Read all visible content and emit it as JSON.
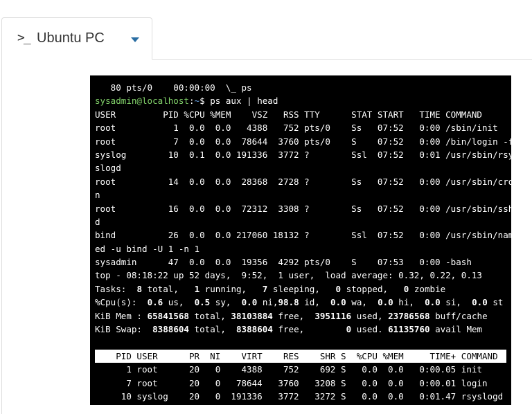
{
  "tab": {
    "prompt_glyph": ">_",
    "label": "Ubuntu PC"
  },
  "terminal": {
    "colors": {
      "background": "#000000",
      "text": "#ffffff",
      "user_host": "#82d26a",
      "path": "#6da6e8"
    },
    "line0": "   80 pts/0    00:00:00  \\_ ps",
    "prompt": {
      "user_host": "sysadmin@localhost",
      "sep": ":",
      "path": "~",
      "symbol": "$ ",
      "command": "ps aux | head"
    },
    "ps": [
      "USER         PID %CPU %MEM    VSZ   RSS TTY      STAT START   TIME COMMAND",
      "root           1  0.0  0.0   4388   752 pts/0    Ss   07:52   0:00 /sbin/init",
      "root           7  0.0  0.0  78644  3760 pts/0    S    07:52   0:00 /bin/login -f",
      "syslog        10  0.1  0.0 191336  3772 ?        Ssl  07:52   0:01 /usr/sbin/rsy",
      "slogd",
      "root          14  0.0  0.0  28368  2728 ?        Ss   07:52   0:00 /usr/sbin/cro",
      "n",
      "root          16  0.0  0.0  72312  3308 ?        Ss   07:52   0:00 /usr/sbin/ssh",
      "d",
      "bind          26  0.0  0.0 217060 18132 ?        Ssl  07:52   0:00 /usr/sbin/nam",
      "ed -u bind -U 1 -n 1",
      "sysadmin      47  0.0  0.0  19356  4292 pts/0    S    07:53   0:00 -bash"
    ],
    "top": {
      "summary": "top - 08:18:22 up 52 days,  9:52,  1 user,  load average: 0.32, 0.22, 0.13",
      "tasks": {
        "label": "Tasks: ",
        "total": "8",
        "total_label": " total, ",
        "running": "1",
        "running_label": " running, ",
        "sleeping": "7",
        "sleeping_label": " sleeping, ",
        "stopped": "0",
        "stopped_label": " stopped, ",
        "zombie": "0",
        "zombie_label": " zombie"
      },
      "cpu": {
        "label": "%Cpu(s): ",
        "us": "0.6",
        "us_label": " us, ",
        "sy": "0.5",
        "sy_label": " sy, ",
        "ni": "0.0",
        "ni_label": " ni,",
        "id": "98.8",
        "id_label": " id, ",
        "wa": "0.0",
        "wa_label": " wa, ",
        "hi": "0.0",
        "hi_label": " hi, ",
        "si": "0.0",
        "si_label": " si, ",
        "st": "0.0",
        "st_label": " st"
      },
      "mem": {
        "label": "KiB Mem : ",
        "total": "65841568",
        "total_label": " total, ",
        "free": "38103884",
        "free_label": " free, ",
        "used": "3951116",
        "used_label": " used, ",
        "cache": "23786568",
        "cache_label": " buff/cache"
      },
      "swap": {
        "label": "KiB Swap: ",
        "total": "8388604",
        "total_label": " total, ",
        "free": "8388604",
        "free_label": " free, ",
        "used": "0",
        "used_label": " used. ",
        "avail": "61135760",
        "avail_label": " avail Mem"
      },
      "header": "    PID USER      PR  NI    VIRT    RES    SHR S  %CPU %MEM     TIME+ COMMAND",
      "rows": [
        "      1 root      20   0    4388    752    692 S   0.0  0.0   0:00.05 init",
        "      7 root      20   0   78644   3760   3208 S   0.0  0.0   0:00.01 login",
        "     10 syslog    20   0  191336   3772   3272 S   0.0  0.0   0:01.47 rsyslogd"
      ]
    }
  }
}
